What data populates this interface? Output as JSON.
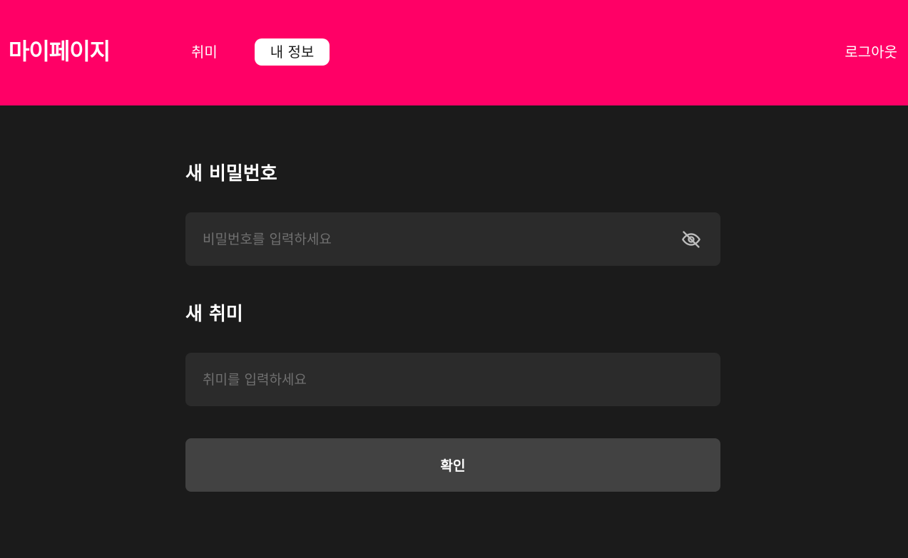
{
  "header": {
    "brand": "마이페이지",
    "tabs": [
      {
        "label": "취미",
        "active": false
      },
      {
        "label": "내 정보",
        "active": true
      }
    ],
    "logout_label": "로그아웃",
    "background_color": "#ff0066"
  },
  "form": {
    "password": {
      "label": "새 비밀번호",
      "placeholder": "비밀번호를 입력하세요",
      "value": "",
      "toggle_icon": "eye-off-icon"
    },
    "hobby": {
      "label": "새 취미",
      "placeholder": "취미를 입력하세요",
      "value": ""
    },
    "confirm_label": "확인"
  },
  "colors": {
    "page_background": "#1b1b1b",
    "input_background": "#2b2b2b",
    "button_background": "#424242"
  }
}
